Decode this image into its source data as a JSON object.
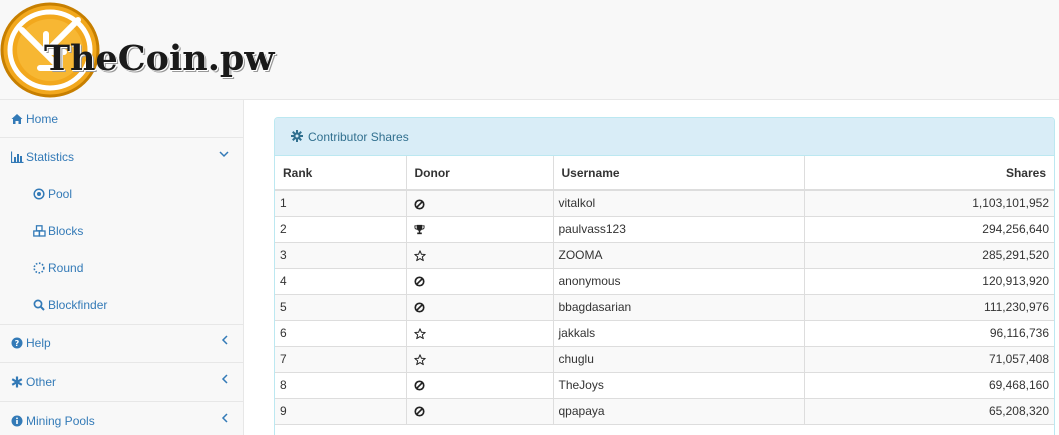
{
  "brand": {
    "name": "TheCoin.pw"
  },
  "sidebar": {
    "items": [
      {
        "label": "Home",
        "icon": "home-icon"
      },
      {
        "label": "Statistics",
        "icon": "bar-chart-icon",
        "expanded": true,
        "children": [
          {
            "label": "Pool",
            "icon": "dot-circle-icon"
          },
          {
            "label": "Blocks",
            "icon": "cubes-icon"
          },
          {
            "label": "Round",
            "icon": "spinner-icon"
          },
          {
            "label": "Blockfinder",
            "icon": "search-icon"
          }
        ]
      },
      {
        "label": "Help",
        "icon": "question-circle-icon"
      },
      {
        "label": "Other",
        "icon": "asterisk-icon"
      },
      {
        "label": "Mining Pools",
        "icon": "info-circle-icon"
      }
    ]
  },
  "panel": {
    "title": "Contributor Shares",
    "icon": "cog-icon",
    "columns": [
      "Rank",
      "Donor",
      "Username",
      "Shares"
    ],
    "rows": [
      {
        "rank": "1",
        "donor": "ban-icon",
        "username": "vitalkol",
        "shares": "1,103,101,952"
      },
      {
        "rank": "2",
        "donor": "trophy-icon",
        "username": "paulvass123",
        "shares": "294,256,640"
      },
      {
        "rank": "3",
        "donor": "star-outline-icon",
        "username": "ZOOMA",
        "shares": "285,291,520"
      },
      {
        "rank": "4",
        "donor": "ban-icon",
        "username": "anonymous",
        "shares": "120,913,920"
      },
      {
        "rank": "5",
        "donor": "ban-icon",
        "username": "bbagdasarian",
        "shares": "111,230,976"
      },
      {
        "rank": "6",
        "donor": "star-outline-icon",
        "username": "jakkals",
        "shares": "96,116,736"
      },
      {
        "rank": "7",
        "donor": "star-outline-icon",
        "username": "chuglu",
        "shares": "71,057,408"
      },
      {
        "rank": "8",
        "donor": "ban-icon",
        "username": "TheJoys",
        "shares": "69,468,160"
      },
      {
        "rank": "9",
        "donor": "ban-icon",
        "username": "qpapaya",
        "shares": "65,208,320"
      }
    ]
  },
  "colors": {
    "link": "#337ab7",
    "panel_heading_bg": "#d9edf7",
    "panel_heading_text": "#31708f",
    "coin_orange": "#f2a81d"
  }
}
